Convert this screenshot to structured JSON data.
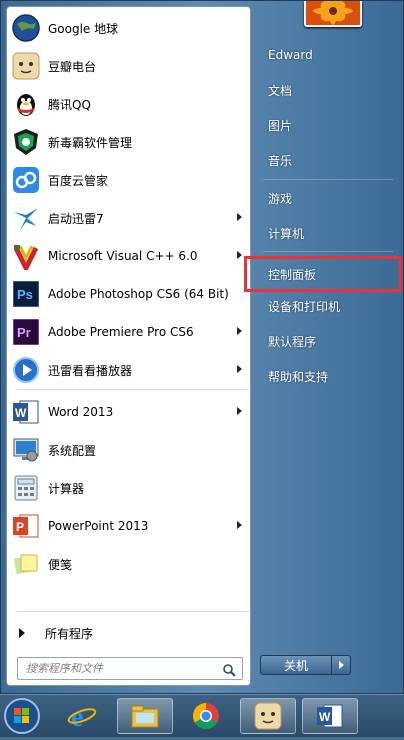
{
  "programs": [
    {
      "label": "Google 地球",
      "icon": "google-earth-icon",
      "arrow": false
    },
    {
      "label": "豆瓣电台",
      "icon": "douban-radio-icon",
      "arrow": false
    },
    {
      "label": "腾讯QQ",
      "icon": "qq-penguin-icon",
      "arrow": false
    },
    {
      "label": "新毒霸软件管理",
      "icon": "duba-software-manager-icon",
      "arrow": false
    },
    {
      "label": "百度云管家",
      "icon": "baidu-cloud-icon",
      "arrow": false
    },
    {
      "label": "启动迅雷7",
      "icon": "xunlei-bird-icon",
      "arrow": true
    },
    {
      "label": "Microsoft Visual C++ 6.0",
      "icon": "visual-cpp-icon",
      "arrow": true
    },
    {
      "label": "Adobe Photoshop CS6 (64 Bit)",
      "icon": "photoshop-icon",
      "arrow": false
    },
    {
      "label": "Adobe Premiere Pro CS6",
      "icon": "premiere-icon",
      "arrow": true
    },
    {
      "label": "迅雷看看播放器",
      "icon": "xunlei-player-icon",
      "arrow": true
    },
    {
      "label": "Word 2013",
      "icon": "word-icon",
      "arrow": true
    },
    {
      "label": "系统配置",
      "icon": "system-config-icon",
      "arrow": false
    },
    {
      "label": "计算器",
      "icon": "calculator-icon",
      "arrow": false
    },
    {
      "label": "PowerPoint 2013",
      "icon": "powerpoint-icon",
      "arrow": true
    },
    {
      "label": "便笺",
      "icon": "sticky-notes-icon",
      "arrow": false
    }
  ],
  "all_programs_label": "所有程序",
  "search": {
    "placeholder": "搜索程序和文件"
  },
  "right": {
    "user": "Edward",
    "items": [
      "文档",
      "图片",
      "音乐",
      "游戏",
      "计算机",
      "控制面板",
      "设备和打印机",
      "默认程序",
      "帮助和支持"
    ],
    "highlighted": "控制面板"
  },
  "shutdown_label": "关机",
  "taskbar": [
    "start-orb",
    "ie-icon",
    "file-explorer-icon",
    "chrome-icon",
    "douban-radio-icon",
    "word-icon"
  ],
  "colors": {
    "highlight": "#e8333a",
    "menu_blue": "#4f7aa3"
  }
}
